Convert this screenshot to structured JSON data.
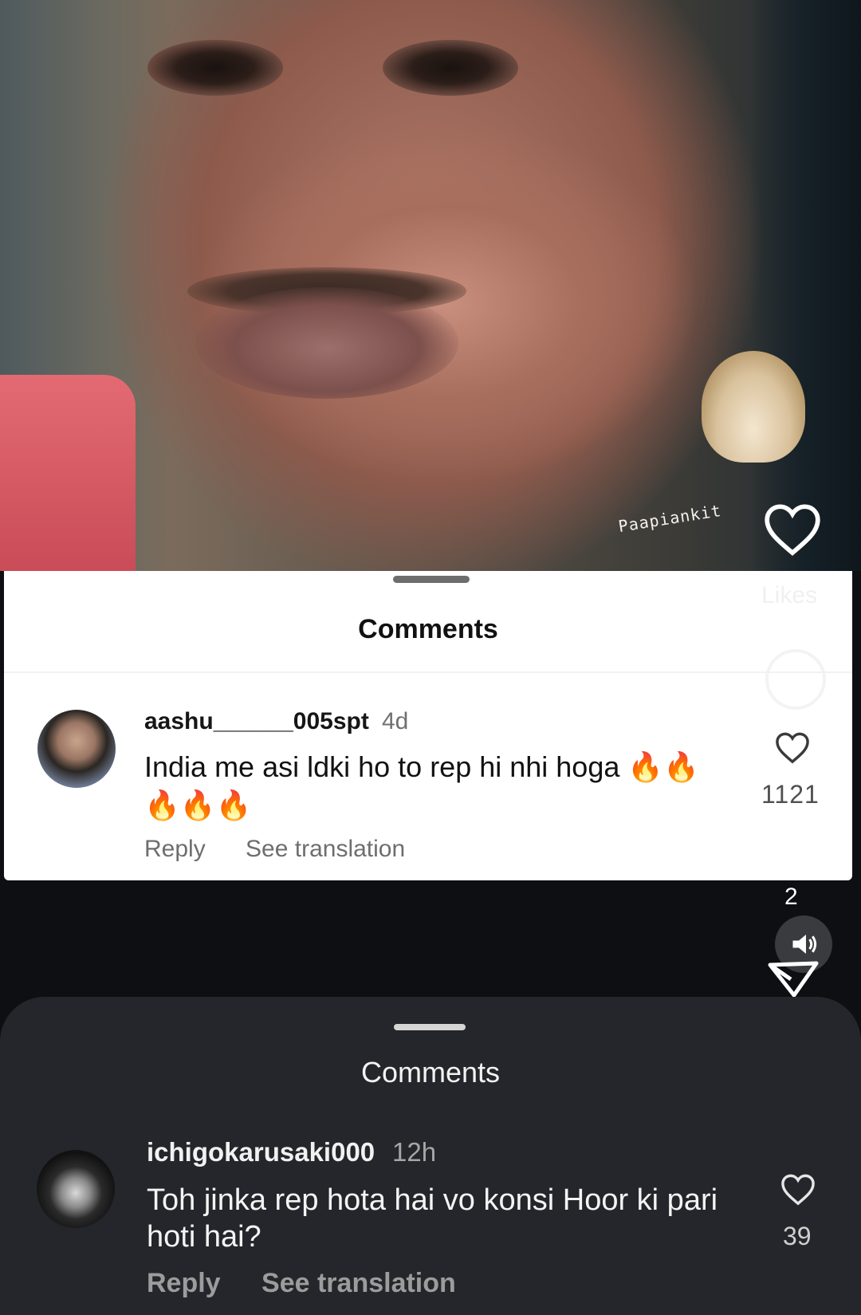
{
  "reel": {
    "watermark": "Paapiankit",
    "faint_likes_label": "Likes",
    "share_count": "2"
  },
  "card_light": {
    "title": "Comments",
    "comment": {
      "username": "aashu______005spt",
      "time": "4d",
      "text": "India me asi ldki ho to rep hi nhi hoga 🔥🔥🔥🔥🔥",
      "reply_label": "Reply",
      "translate_label": "See translation",
      "likes": "1121"
    }
  },
  "sheet_dark": {
    "title": "Comments",
    "comment": {
      "username": "ichigokarusaki000",
      "time": "12h",
      "text": "Toh jinka rep hota hai vo konsi Hoor ki pari hoti hai?",
      "reply_label": "Reply",
      "translate_label": "See translation",
      "likes": "39"
    }
  }
}
